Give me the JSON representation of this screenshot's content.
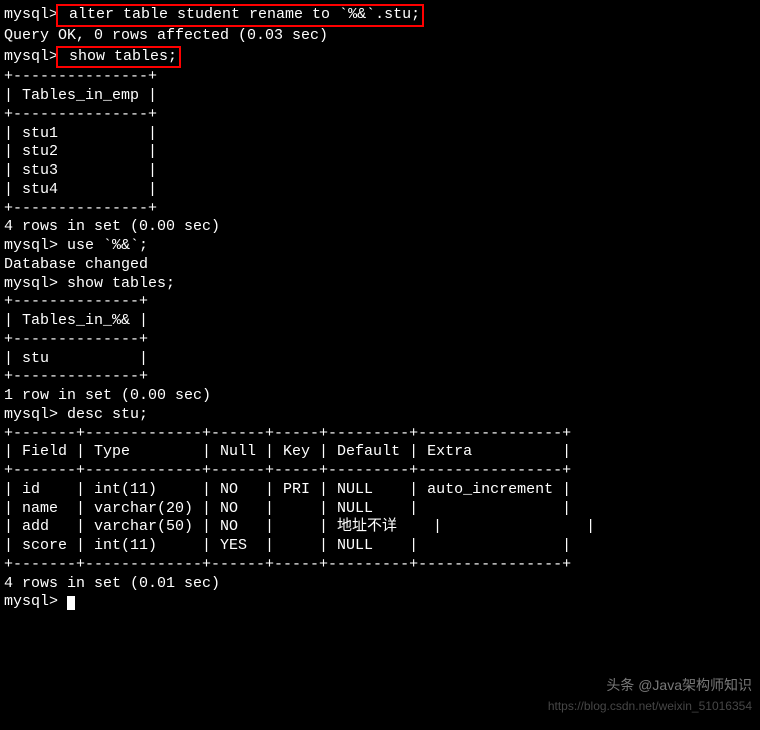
{
  "prompt": "mysql>",
  "cmd1": " alter table student rename to `%&`.stu;",
  "res1": "Query OK, 0 rows affected (0.03 sec)",
  "blank": "",
  "cmd2": " show tables;",
  "table1": {
    "sep": "+---------------+",
    "header": "| Tables_in_emp |",
    "rows": [
      "| stu1          |",
      "| stu2          |",
      "| stu3          |",
      "| stu4          |"
    ],
    "footer": "4 rows in set (0.00 sec)"
  },
  "cmd3": "mysql> use `%&`;",
  "res3": "Database changed",
  "cmd4": "mysql> show tables;",
  "table2": {
    "sep": "+--------------+",
    "header": "| Tables_in_%& |",
    "rows": [
      "| stu          |"
    ],
    "footer": "1 row in set (0.00 sec)"
  },
  "cmd5": "mysql> desc stu;",
  "table3": {
    "sep": "+-------+-------------+------+-----+---------+----------------+",
    "header": "| Field | Type        | Null | Key | Default | Extra          |",
    "rows": [
      "| id    | int(11)     | NO   | PRI | NULL    | auto_increment |",
      "| name  | varchar(20) | NO   |     | NULL    |                |",
      "| add   | varchar(50) | NO   |     | 地址不详    |                |",
      "| score | int(11)     | YES  |     | NULL    |                |"
    ],
    "footer": "4 rows in set (0.01 sec)"
  },
  "watermark1": "头条 @Java架构师知识",
  "watermark2": "https://blog.csdn.net/weixin_51016354",
  "chart_data": {
    "type": "table",
    "title": "desc stu",
    "columns": [
      "Field",
      "Type",
      "Null",
      "Key",
      "Default",
      "Extra"
    ],
    "rows": [
      {
        "Field": "id",
        "Type": "int(11)",
        "Null": "NO",
        "Key": "PRI",
        "Default": "NULL",
        "Extra": "auto_increment"
      },
      {
        "Field": "name",
        "Type": "varchar(20)",
        "Null": "NO",
        "Key": "",
        "Default": "NULL",
        "Extra": ""
      },
      {
        "Field": "add",
        "Type": "varchar(50)",
        "Null": "NO",
        "Key": "",
        "Default": "地址不详",
        "Extra": ""
      },
      {
        "Field": "score",
        "Type": "int(11)",
        "Null": "YES",
        "Key": "",
        "Default": "NULL",
        "Extra": ""
      }
    ]
  }
}
